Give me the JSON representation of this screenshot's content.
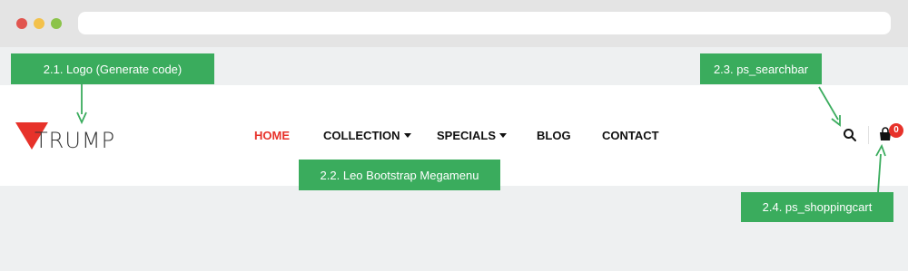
{
  "browser": {
    "traffic_lights": [
      "#e1554f",
      "#f3c14b",
      "#8bc34a"
    ]
  },
  "logo": {
    "text": "TRUMP",
    "accent_color": "#e7322a"
  },
  "nav": {
    "items": [
      {
        "label": "HOME",
        "active": true,
        "dropdown": false
      },
      {
        "label": "COLLECTION",
        "active": false,
        "dropdown": true
      },
      {
        "label": "SPECIALS",
        "active": false,
        "dropdown": true
      },
      {
        "label": "BLOG",
        "active": false,
        "dropdown": false
      },
      {
        "label": "CONTACT",
        "active": false,
        "dropdown": false
      }
    ]
  },
  "header_icons": {
    "search": "search-icon",
    "cart": "shopping-bag-icon",
    "cart_count": "0"
  },
  "annotations": {
    "logo": "2.1. Logo (Generate code)",
    "searchbar": "2.3. ps_searchbar",
    "megamenu": "2.2. Leo Bootstrap Megamenu",
    "shoppingcart": "2.4. ps_shoppingcart"
  },
  "colors": {
    "annotation_green": "#3aac5d",
    "active_nav": "#e7322a",
    "page_bg": "#eef0f1"
  }
}
